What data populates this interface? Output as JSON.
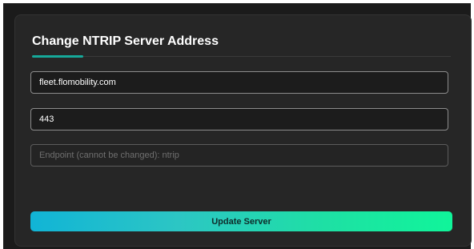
{
  "dialog": {
    "title": "Change NTRIP Server Address"
  },
  "form": {
    "host_value": "fleet.flomobility.com",
    "port_value": "443",
    "endpoint_placeholder": "Endpoint (cannot be changed): ntrip"
  },
  "actions": {
    "update_label": "Update Server"
  },
  "colors": {
    "accent": "#16a99a",
    "button_gradient_start": "#11b4d6",
    "button_gradient_end": "#10f59a",
    "panel_bg": "#262626"
  }
}
